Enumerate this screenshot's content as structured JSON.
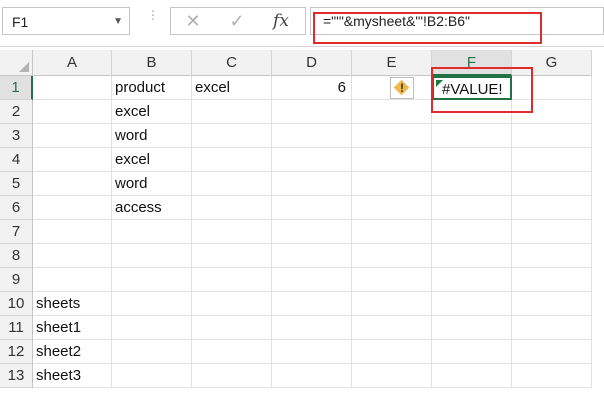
{
  "namebox": {
    "value": "F1",
    "dropdown_icon": "triangle-down"
  },
  "formula_buttons": {
    "cancel": "✕",
    "enter": "✓",
    "fx": "fx"
  },
  "formula": {
    "text": "=\"'\"&mysheet&\"'!B2:B6\""
  },
  "columns": [
    "A",
    "B",
    "C",
    "D",
    "E",
    "F",
    "G"
  ],
  "rows": [
    "1",
    "2",
    "3",
    "4",
    "5",
    "6",
    "7",
    "8",
    "9",
    "10",
    "11",
    "12",
    "13"
  ],
  "cells": {
    "B1": "product",
    "C1": "excel",
    "D1": "6",
    "F1": "#VALUE!",
    "B2": "excel",
    "B3": "word",
    "B4": "excel",
    "B5": "word",
    "B6": "access",
    "A10": "sheets",
    "A11": "sheet1",
    "A12": "sheet2",
    "A13": "sheet3"
  },
  "selected_cell": "F1",
  "colors": {
    "accent": "#217346",
    "highlight": "#e02b2b",
    "warning": "#f0b84a"
  }
}
